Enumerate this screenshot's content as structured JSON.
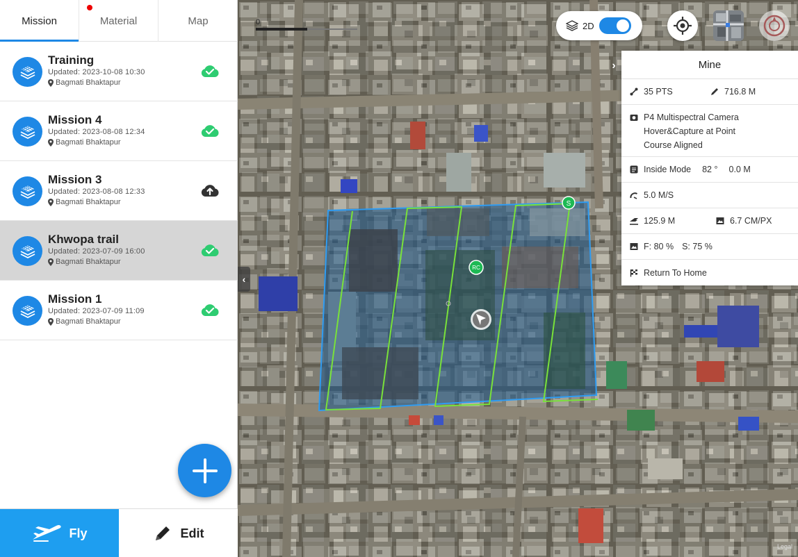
{
  "tabs": [
    {
      "label": "Mission"
    },
    {
      "label": "Material"
    },
    {
      "label": "Map"
    }
  ],
  "missions": [
    {
      "title": "Training",
      "updated": "Updated: 2023-10-08 10:30",
      "location": "Bagmati Bhaktapur",
      "sync": "cloud-check-icon",
      "sync_color": "#2ecc71"
    },
    {
      "title": "Mission 4",
      "updated": "Updated: 2023-08-08 12:34",
      "location": "Bagmati Bhaktapur",
      "sync": "cloud-check-icon",
      "sync_color": "#2ecc71"
    },
    {
      "title": "Mission 3",
      "updated": "Updated: 2023-08-08 12:33",
      "location": "Bagmati Bhaktapur",
      "sync": "cloud-upload-icon",
      "sync_color": "#333333"
    },
    {
      "title": "Khwopa trail",
      "updated": "Updated: 2023-07-09 16:00",
      "location": "Bagmati Bhaktapur",
      "sync": "cloud-check-icon",
      "sync_color": "#2ecc71",
      "selected": true
    },
    {
      "title": "Mission 1",
      "updated": "Updated: 2023-07-09 11:09",
      "location": "Bagmati Bhaktapur",
      "sync": "cloud-check-icon",
      "sync_color": "#2ecc71"
    }
  ],
  "bottom": {
    "fly_label": "Fly",
    "edit_label": "Edit"
  },
  "map": {
    "scale_label": "0",
    "view_mode_label": "2D",
    "view_mode_on": true,
    "start_marker": "S",
    "rc_marker": "RC",
    "legal": "Legal"
  },
  "info": {
    "title": "Mine",
    "points": "35 PTS",
    "distance": "716.8 M",
    "camera": "P4 Multispectral Camera",
    "capture_mode": "Hover&Capture at Point",
    "course": "Course Aligned",
    "mode": "Inside Mode",
    "angle": "82 °",
    "margin": "0.0 M",
    "speed": "5.0 M/S",
    "altitude": "125.9 M",
    "gsd": "6.7 CM/PX",
    "overlap_front": "F: 80 %",
    "overlap_side": "S: 75 %",
    "finish_action": "Return To Home"
  },
  "colors": {
    "accent": "#1e88e5",
    "fly_button": "#1e9ef0",
    "boundary": "#2f9cf2",
    "flight_path": "#79e23a",
    "marker": "#1db954"
  }
}
